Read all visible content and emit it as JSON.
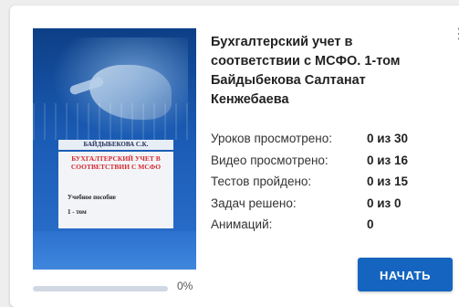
{
  "course": {
    "title": "Бухгалтерский учет в соответствии с МСФО. 1-том Байдыбекова Салтанат Кенжебаева",
    "cover": {
      "author": "БАЙДЫБЕКОВА С.К.",
      "book_title": "БУХГАЛТЕРСКИЙ УЧЕТ В СООТВЕТСТВИИ С МСФО",
      "subtitle": "Учебное пособие",
      "volume": "1 - том"
    },
    "stats": [
      {
        "label": "Уроков просмотрено:",
        "value": "0 из 30"
      },
      {
        "label": "Видео просмотрено:",
        "value": "0 из 16"
      },
      {
        "label": "Тестов пройдено:",
        "value": "0 из 15"
      },
      {
        "label": "Задач решено:",
        "value": "0 из 0"
      },
      {
        "label": "Анимаций:",
        "value": "0"
      }
    ],
    "progress": {
      "percent": 0,
      "label": "0%"
    },
    "start_label": "НАЧАТЬ",
    "menu_icon": "more-vertical-icon"
  },
  "colors": {
    "accent": "#1565c0",
    "progress_track": "#cfd8e3",
    "cover_blue": "#1a5bb4",
    "cover_title_red": "#d7282f"
  }
}
